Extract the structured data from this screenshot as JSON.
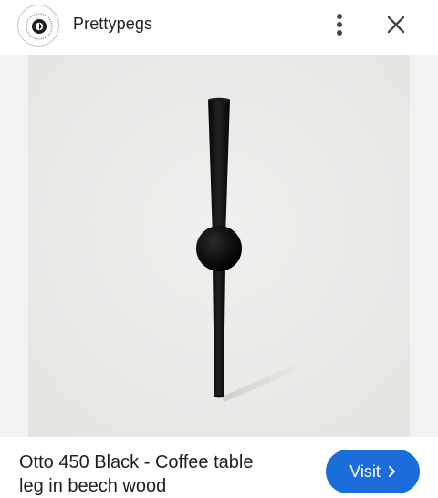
{
  "header": {
    "site_name": "Prettypegs",
    "logo_icon": "prettypegs-logo-icon",
    "more_icon": "more-vertical-icon",
    "close_icon": "close-icon"
  },
  "image": {
    "subject": "black coffee table leg with sphere"
  },
  "footer": {
    "title_line1": "Otto 450 Black - Coffee table",
    "title_line2": "leg in beech wood",
    "visit_label": "Visit",
    "visit_icon": "chevron-right-icon"
  },
  "colors": {
    "accent": "#1a6ddb",
    "photo_bg": "#ecebe9",
    "product": "#0d0d0d"
  }
}
